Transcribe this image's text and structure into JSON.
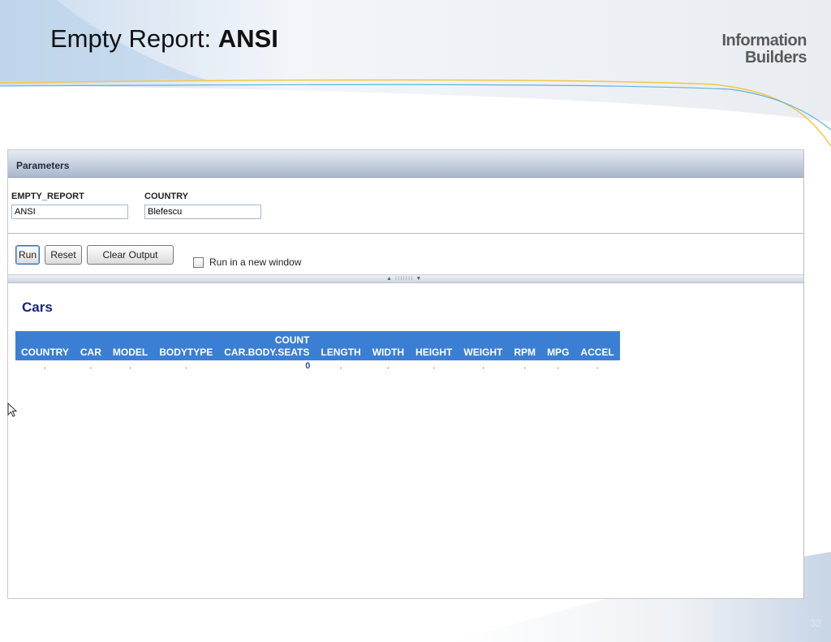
{
  "slide": {
    "title_prefix": "Empty Report: ",
    "title_emphasis": "ANSI",
    "logo_line1": "Information",
    "logo_line2": "Builders",
    "slide_number": "32"
  },
  "parameters": {
    "header": "Parameters",
    "fields": [
      {
        "label": "EMPTY_REPORT",
        "value": "ANSI"
      },
      {
        "label": "COUNTRY",
        "value": "Blefescu"
      }
    ]
  },
  "actions": {
    "run_label": "Run",
    "reset_label": "Reset",
    "clear_label": "Clear Output",
    "new_window_label": "Run in a new window"
  },
  "splitter": {
    "grip": "▲ ⁝⁝⁝⁝⁝⁝⁝ ▼"
  },
  "report": {
    "title": "Cars",
    "columns": [
      {
        "top": "",
        "bottom": "COUNTRY"
      },
      {
        "top": "",
        "bottom": "CAR"
      },
      {
        "top": "",
        "bottom": "MODEL"
      },
      {
        "top": "",
        "bottom": "BODYTYPE"
      },
      {
        "top": "COUNT",
        "bottom": "CAR.BODY.SEATS"
      },
      {
        "top": "",
        "bottom": "LENGTH"
      },
      {
        "top": "",
        "bottom": "WIDTH"
      },
      {
        "top": "",
        "bottom": "HEIGHT"
      },
      {
        "top": "",
        "bottom": "WEIGHT"
      },
      {
        "top": "",
        "bottom": "RPM"
      },
      {
        "top": "",
        "bottom": "MPG"
      },
      {
        "top": "",
        "bottom": "ACCEL"
      }
    ],
    "row": [
      ".",
      ".",
      ".",
      ".",
      "0",
      ".",
      ".",
      ".",
      ".",
      ".",
      ".",
      "."
    ]
  },
  "colors": {
    "header_blue": "#3b7fd4",
    "title_navy": "#1a237e",
    "swoosh_yellow": "#f2c744",
    "swoosh_blue": "#5fb3dd"
  }
}
